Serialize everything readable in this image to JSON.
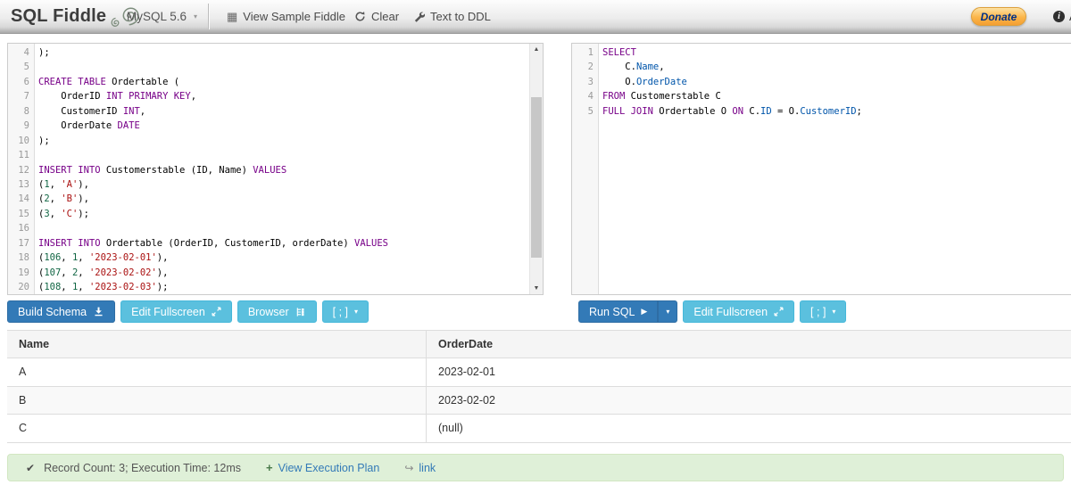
{
  "header": {
    "logo": "SQL Fiddle",
    "logo_icon": "nautilus-shell-icon",
    "db_select": "MySQL 5.6",
    "menu": [
      {
        "label": "View Sample Fiddle",
        "icon": "grid-table-icon"
      },
      {
        "label": "Clear",
        "icon": "refresh-icon"
      },
      {
        "label": "Text to DDL",
        "icon": "wrench-icon"
      }
    ],
    "donate_label": "Donate",
    "about_label": "A",
    "about_icon": "info-icon"
  },
  "schema_editor": {
    "first_line_number": 4,
    "lines": [
      [
        {
          "t": "plain",
          "v": ");"
        }
      ],
      [],
      [
        {
          "t": "kw",
          "v": "CREATE TABLE"
        },
        {
          "t": "plain",
          "v": " Ordertable ("
        }
      ],
      [
        {
          "t": "plain",
          "v": "    OrderID "
        },
        {
          "t": "kw",
          "v": "INT PRIMARY KEY"
        },
        {
          "t": "plain",
          "v": ","
        }
      ],
      [
        {
          "t": "plain",
          "v": "    CustomerID "
        },
        {
          "t": "kw",
          "v": "INT"
        },
        {
          "t": "plain",
          "v": ","
        }
      ],
      [
        {
          "t": "plain",
          "v": "    OrderDate "
        },
        {
          "t": "kw",
          "v": "DATE"
        }
      ],
      [
        {
          "t": "plain",
          "v": ");"
        }
      ],
      [],
      [
        {
          "t": "kw",
          "v": "INSERT INTO"
        },
        {
          "t": "plain",
          "v": " Customerstable (ID, Name) "
        },
        {
          "t": "kw",
          "v": "VALUES"
        }
      ],
      [
        {
          "t": "plain",
          "v": "("
        },
        {
          "t": "num",
          "v": "1"
        },
        {
          "t": "plain",
          "v": ", "
        },
        {
          "t": "str",
          "v": "'A'"
        },
        {
          "t": "plain",
          "v": "),"
        }
      ],
      [
        {
          "t": "plain",
          "v": "("
        },
        {
          "t": "num",
          "v": "2"
        },
        {
          "t": "plain",
          "v": ", "
        },
        {
          "t": "str",
          "v": "'B'"
        },
        {
          "t": "plain",
          "v": "),"
        }
      ],
      [
        {
          "t": "plain",
          "v": "("
        },
        {
          "t": "num",
          "v": "3"
        },
        {
          "t": "plain",
          "v": ", "
        },
        {
          "t": "str",
          "v": "'C'"
        },
        {
          "t": "plain",
          "v": ");"
        }
      ],
      [],
      [
        {
          "t": "kw",
          "v": "INSERT INTO"
        },
        {
          "t": "plain",
          "v": " Ordertable (OrderID, CustomerID, orderDate) "
        },
        {
          "t": "kw",
          "v": "VALUES"
        }
      ],
      [
        {
          "t": "plain",
          "v": "("
        },
        {
          "t": "num",
          "v": "106"
        },
        {
          "t": "plain",
          "v": ", "
        },
        {
          "t": "num",
          "v": "1"
        },
        {
          "t": "plain",
          "v": ", "
        },
        {
          "t": "str",
          "v": "'2023-02-01'"
        },
        {
          "t": "plain",
          "v": "),"
        }
      ],
      [
        {
          "t": "plain",
          "v": "("
        },
        {
          "t": "num",
          "v": "107"
        },
        {
          "t": "plain",
          "v": ", "
        },
        {
          "t": "num",
          "v": "2"
        },
        {
          "t": "plain",
          "v": ", "
        },
        {
          "t": "str",
          "v": "'2023-02-02'"
        },
        {
          "t": "plain",
          "v": "),"
        }
      ],
      [
        {
          "t": "plain",
          "v": "("
        },
        {
          "t": "num",
          "v": "108"
        },
        {
          "t": "plain",
          "v": ", "
        },
        {
          "t": "num",
          "v": "1"
        },
        {
          "t": "plain",
          "v": ", "
        },
        {
          "t": "str",
          "v": "'2023-02-03'"
        },
        {
          "t": "plain",
          "v": ");"
        }
      ]
    ]
  },
  "query_editor": {
    "first_line_number": 1,
    "lines": [
      [
        {
          "t": "kw",
          "v": "SELECT"
        }
      ],
      [
        {
          "t": "plain",
          "v": "    C."
        },
        {
          "t": "prop",
          "v": "Name"
        },
        {
          "t": "plain",
          "v": ","
        }
      ],
      [
        {
          "t": "plain",
          "v": "    O."
        },
        {
          "t": "prop",
          "v": "OrderDate"
        }
      ],
      [
        {
          "t": "kw",
          "v": "FROM"
        },
        {
          "t": "plain",
          "v": " Customerstable C"
        }
      ],
      [
        {
          "t": "kw",
          "v": "FULL JOIN"
        },
        {
          "t": "plain",
          "v": " Ordertable O "
        },
        {
          "t": "kw",
          "v": "ON"
        },
        {
          "t": "plain",
          "v": " C."
        },
        {
          "t": "prop",
          "v": "ID"
        },
        {
          "t": "plain",
          "v": " = O."
        },
        {
          "t": "prop",
          "v": "CustomerID"
        },
        {
          "t": "plain",
          "v": ";"
        }
      ]
    ]
  },
  "schema_buttons": {
    "build_schema": {
      "label": "Build Schema",
      "icon": "download-icon"
    },
    "edit_fullscreen": {
      "label": "Edit Fullscreen",
      "icon": "fullscreen-icon"
    },
    "browser": {
      "label": "Browser",
      "icon": "tree-browser-icon"
    },
    "semicolon": {
      "label": "[ ; ]",
      "icon": "chevron-down-icon"
    }
  },
  "query_buttons": {
    "run_sql": {
      "label": "Run SQL",
      "icon": "play-icon"
    },
    "run_sql_dropdown_icon": "chevron-down-icon",
    "edit_fullscreen": {
      "label": "Edit Fullscreen",
      "icon": "fullscreen-icon"
    },
    "semicolon": {
      "label": "[ ; ]",
      "icon": "chevron-down-icon"
    }
  },
  "results": {
    "columns": [
      "Name",
      "OrderDate"
    ],
    "rows": [
      [
        "A",
        "2023-02-01"
      ],
      [
        "B",
        "2023-02-02"
      ],
      [
        "C",
        "(null)"
      ]
    ]
  },
  "status": {
    "icon": "check-icon",
    "message": "Record Count: 3; Execution Time: 12ms",
    "links": [
      {
        "label": "View Execution Plan",
        "icon": "plus-icon"
      },
      {
        "label": "link",
        "icon": "share-arrow-icon"
      }
    ]
  },
  "colors": {
    "keyword": "#770088",
    "number": "#116644",
    "string": "#aa1111",
    "property": "#0055aa",
    "primary_button": "#337ab7",
    "info_button": "#5bc0de",
    "status_bg": "#dff0d8",
    "link": "#337ab7",
    "donate_text": "#003087"
  }
}
